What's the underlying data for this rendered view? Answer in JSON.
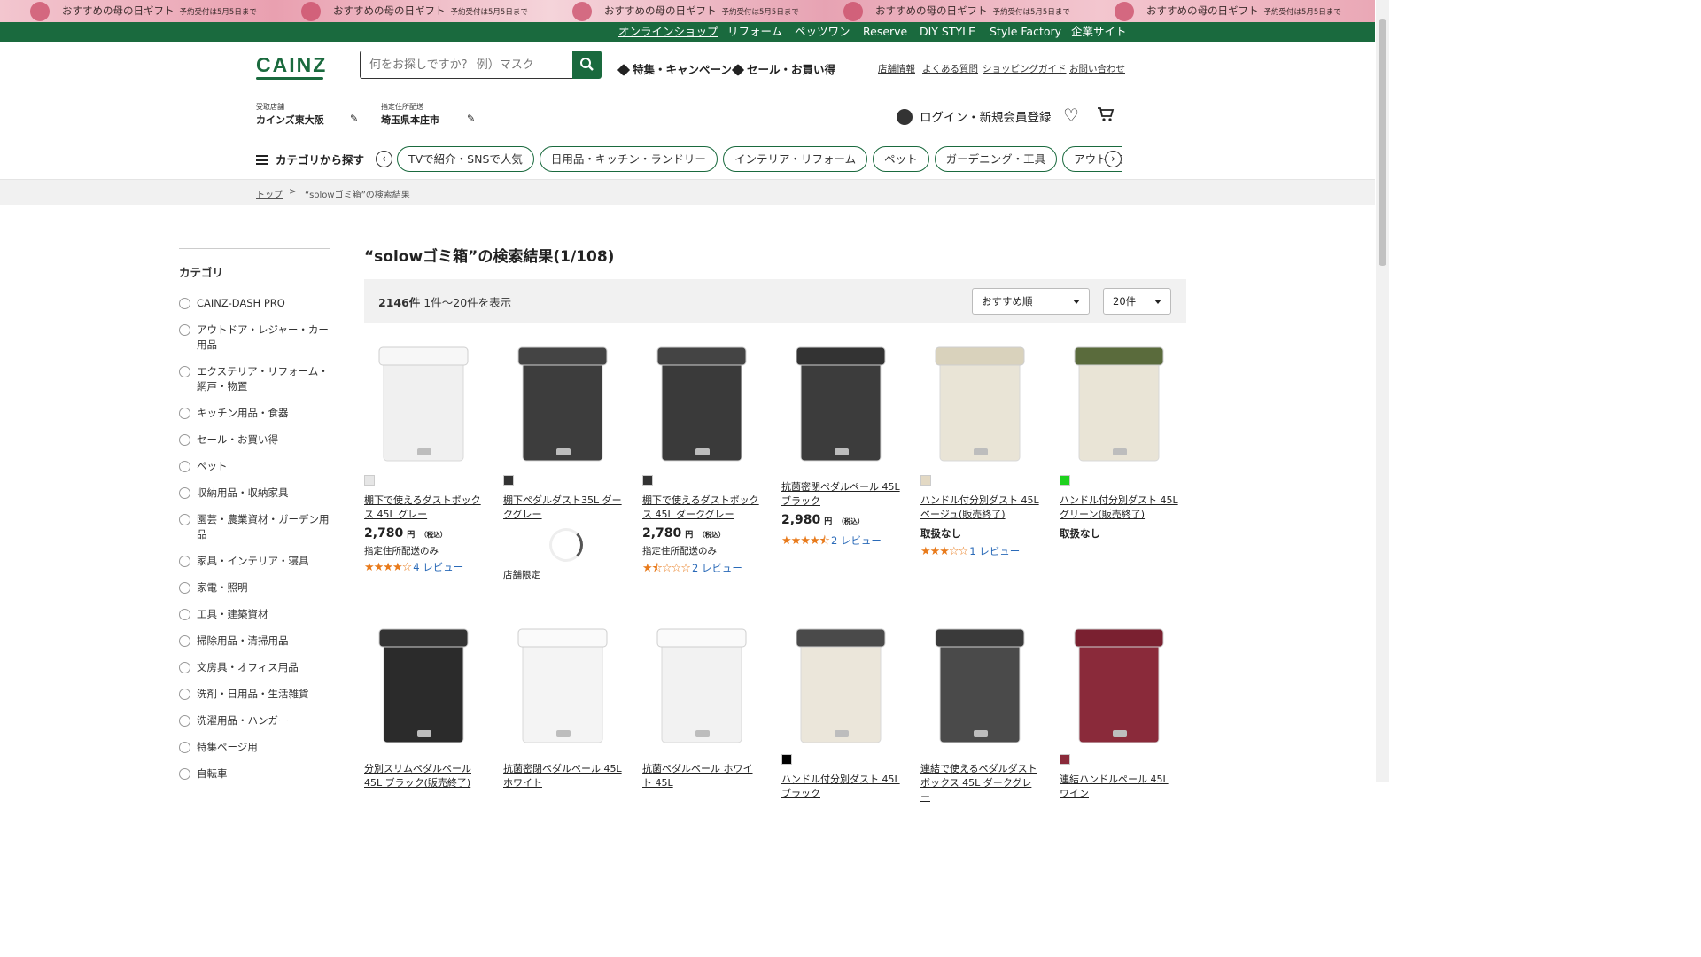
{
  "banner": {
    "text": "おすすめの母の日ギフト",
    "sub": "予約受付は5月5日まで"
  },
  "topnav": [
    "オンラインショップ",
    "リフォーム",
    "ペッツワン",
    "Reserve",
    "DIY STYLE",
    "Style Factory",
    "企業サイト"
  ],
  "header": {
    "logo": "CAINZ",
    "search_placeholder": "何をお探しですか？ 例）マスク",
    "campaign": "特集・キャンペーン",
    "sale": "セール・お買い得",
    "links": [
      "店舗情報",
      "よくある質問",
      "ショッピングガイド",
      "お問い合わせ"
    ],
    "store_label": "受取店舗",
    "store_value": "カインズ東大阪",
    "address_label": "指定住所配送",
    "address_value": "埼玉県本庄市",
    "login": "ログイン・新規会員登録",
    "category_button": "カテゴリから探す",
    "pills": [
      "TVで紹介・SNSで人気",
      "日用品・キッチン・ランドリー",
      "インテリア・リフォーム",
      "ペット",
      "ガーデニング・工具",
      "アウトドア・カー"
    ]
  },
  "breadcrumb": {
    "home": "トップ",
    "sep": ">",
    "current": "“solowゴミ箱”の検索結果"
  },
  "sidebar": {
    "title": "カテゴリ",
    "items": [
      "CAINZ-DASH PRO",
      "アウトドア・レジャー・カー用品",
      "エクステリア・リフォーム・網戸・物置",
      "キッチン用品・食器",
      "セール・お買い得",
      "ペット",
      "収納用品・収納家具",
      "園芸・農業資材・ガーデン用品",
      "家具・インテリア・寝具",
      "家電・照明",
      "工具・建築資材",
      "掃除用品・清掃用品",
      "文房具・オフィス用品",
      "洗剤・日用品・生活雑貨",
      "洗濯用品・ハンガー",
      "特集ページ用",
      "自転車"
    ]
  },
  "results": {
    "title": "“solowゴミ箱”の検索結果(1/108)",
    "count": "2146件",
    "range": "1件〜20件を表示",
    "sort": "おすすめ順",
    "per_page": "20件"
  },
  "products": [
    {
      "name": "棚下で使えるダストボックス 45L グレー",
      "price": "2,780",
      "yen": "円",
      "tax": "（税込）",
      "note": "指定住所配送のみ",
      "stars": "★★★★☆",
      "reviews": "4 レビュー",
      "swatch": "#e6e6e6",
      "body": "#f0f0f0",
      "lid": "#f7f7f7"
    },
    {
      "name": "棚下ペダルダスト35L ダークグレー",
      "price": "",
      "note": "店舗限定",
      "stars": "",
      "reviews": "",
      "swatch": "#333333",
      "body": "#3d3d3d",
      "lid": "#444444"
    },
    {
      "name": "棚下で使えるダストボックス 45L ダークグレー",
      "price": "2,780",
      "yen": "円",
      "tax": "（税込）",
      "note": "指定住所配送のみ",
      "stars": "★⯪☆☆☆",
      "reviews": "2 レビュー",
      "swatch": "#333333",
      "body": "#3a3a3a",
      "lid": "#444444"
    },
    {
      "name": "抗菌密閉ペダルペール 45L ブラック",
      "price": "2,980",
      "yen": "円",
      "tax": "（税込）",
      "note": "",
      "stars": "★★★★⯪",
      "reviews": "2 レビュー",
      "swatch": "",
      "body": "#3c3c3c",
      "lid": "#333333"
    },
    {
      "name": "ハンドル付分別ダスト 45L ベージュ(販売終了)",
      "price": "",
      "note": "取扱なし",
      "stars": "★★★☆☆",
      "reviews": "1 レビュー",
      "swatch": "#e3d9c4",
      "body": "#e9e4d6",
      "lid": "#d9d2bc"
    },
    {
      "name": "ハンドル付分別ダスト 45L グリーン(販売終了)",
      "price": "",
      "note": "取扱なし",
      "stars": "",
      "reviews": "",
      "swatch": "#1ed11e",
      "body": "#e9e4d6",
      "lid": "#5a6b3c"
    },
    {
      "name": "分別スリムペダルペール 45L ブラック(販売終了)",
      "swatch": "",
      "body": "#2b2b2b",
      "lid": "#333333"
    },
    {
      "name": "抗菌密閉ペダルペール 45L ホワイト",
      "swatch": "",
      "body": "#f4f4f4",
      "lid": "#fafafa"
    },
    {
      "name": "抗菌ペダルペール ホワイト 45L",
      "swatch": "",
      "body": "#f2f2f2",
      "lid": "#fafafa"
    },
    {
      "name": "ハンドル付分別ダスト 45L ブラック",
      "swatch": "#000000",
      "body": "#ebe6da",
      "lid": "#4a4a4a"
    },
    {
      "name": "連結で使えるペダルダスト ボックス 45L ダークグレー",
      "swatch": "",
      "body": "#4a4a4a",
      "lid": "#3a3a3a"
    },
    {
      "name": "連結ハンドルペール 45L ワイン",
      "swatch": "#8a2a3a",
      "body": "#8a2a3a",
      "lid": "#7a2030"
    }
  ],
  "colors": {
    "brand": "#1a6a3e",
    "star": "#e87a1b",
    "review_link": "#2a6ab8"
  },
  "icons": [
    "search-icon",
    "tag-icon",
    "pencil-icon",
    "user-icon",
    "heart-icon",
    "cart-icon",
    "menu-icon",
    "chevron-left-icon",
    "chevron-right-icon",
    "loading-spinner-icon",
    "chevron-down-icon"
  ]
}
